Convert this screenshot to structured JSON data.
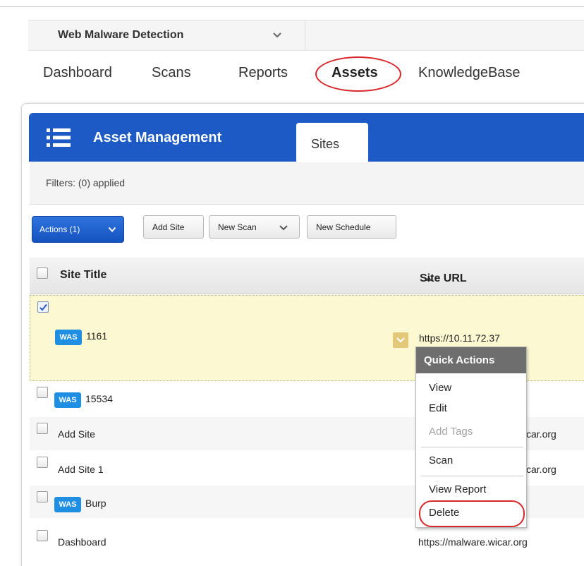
{
  "app": {
    "name": "Web Malware Detection"
  },
  "nav": {
    "tabs": [
      "Dashboard",
      "Scans",
      "Reports",
      "Assets",
      "KnowledgeBase"
    ],
    "active": "Assets"
  },
  "module": {
    "title": "Asset Management",
    "tab": "Sites"
  },
  "filters": {
    "text": "Filters: (0) applied"
  },
  "toolbar": {
    "actions_label": "Actions (1)",
    "add_site_label": "Add Site",
    "new_scan_label": "New Scan",
    "new_schedule_label": "New Schedule"
  },
  "grid": {
    "columns": [
      "Site Title",
      "Site URL"
    ],
    "sort_column": "Site Title",
    "sort_direction": "ascending",
    "badge_label": "WAS",
    "rows": [
      {
        "title": "1161",
        "url": "https://10.11.72.37",
        "badge": true,
        "checked": true
      },
      {
        "title": "15534",
        "url": "",
        "badge": true,
        "checked": false
      },
      {
        "title": "Add Site",
        "url": "car.org",
        "badge": false,
        "checked": false
      },
      {
        "title": "Add Site 1",
        "url": "car.org",
        "badge": false,
        "checked": false
      },
      {
        "title": "Burp",
        "url": "",
        "badge": true,
        "checked": false
      },
      {
        "title": "Dashboard",
        "url": "https://malware.wicar.org",
        "badge": false,
        "checked": false
      }
    ]
  },
  "quick_actions": {
    "title": "Quick Actions",
    "items": [
      "View",
      "Edit",
      "Add Tags",
      "Scan",
      "View Report",
      "Delete"
    ],
    "disabled": [
      "Add Tags"
    ]
  },
  "colors": {
    "primary_blue": "#1d5ac6",
    "selected_row": "#fcf8d1",
    "badge_blue": "#1f8fe3",
    "annotation_red": "#d9262a",
    "menu_header": "#6e6e6e"
  },
  "icons": {
    "module": "list-icon",
    "app_switcher": "chevron-down-icon",
    "sort": "sort-up-icon",
    "row_menu": "chevron-down-icon"
  }
}
